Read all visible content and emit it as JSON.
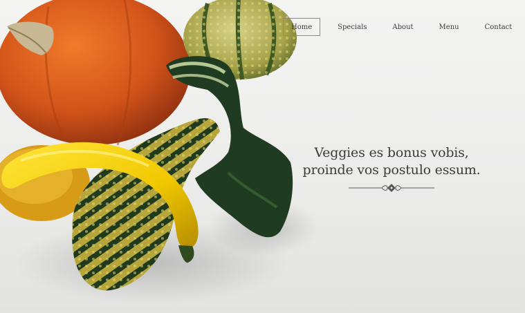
{
  "nav": {
    "items": [
      {
        "label": "Home",
        "active": true
      },
      {
        "label": "Specials",
        "active": false
      },
      {
        "label": "About",
        "active": false
      },
      {
        "label": "Menu",
        "active": false
      },
      {
        "label": "Contact",
        "active": false
      }
    ]
  },
  "hero": {
    "headline_line1": "Veggies es bonus vobis,",
    "headline_line2": "proinde vos postulo essum.",
    "ornament_icon": "flourish-divider-icon"
  },
  "colors": {
    "background": "#efefee",
    "text": "#3b3b3b",
    "nav_active_border": "#8a8a8a"
  }
}
